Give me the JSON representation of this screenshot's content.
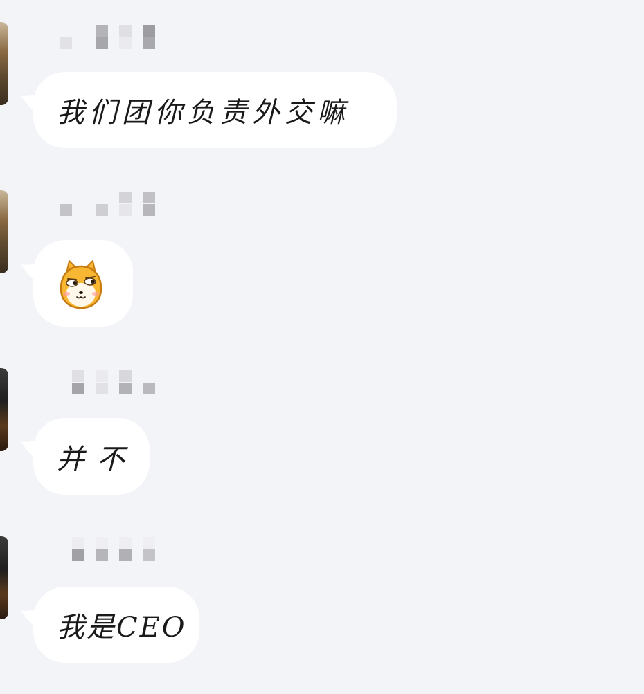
{
  "messages": [
    {
      "id": "m1",
      "type": "text",
      "text": "我们团你负责外交嘛",
      "avatar": "avatar-landscape"
    },
    {
      "id": "m2",
      "type": "sticker",
      "sticker": "shiba-dog-side-eye-icon",
      "avatar": "avatar-landscape"
    },
    {
      "id": "m3",
      "type": "text",
      "text": "并不",
      "avatar": "avatar-night-city"
    },
    {
      "id": "m4",
      "type": "text",
      "text": "我是CEO",
      "avatar": "avatar-night-city"
    }
  ],
  "colors": {
    "background": "#f3f4f8",
    "bubble": "#ffffff",
    "text": "#1a1a1a",
    "sticker_face": "#f7b733",
    "sticker_outline": "#c77a10"
  }
}
